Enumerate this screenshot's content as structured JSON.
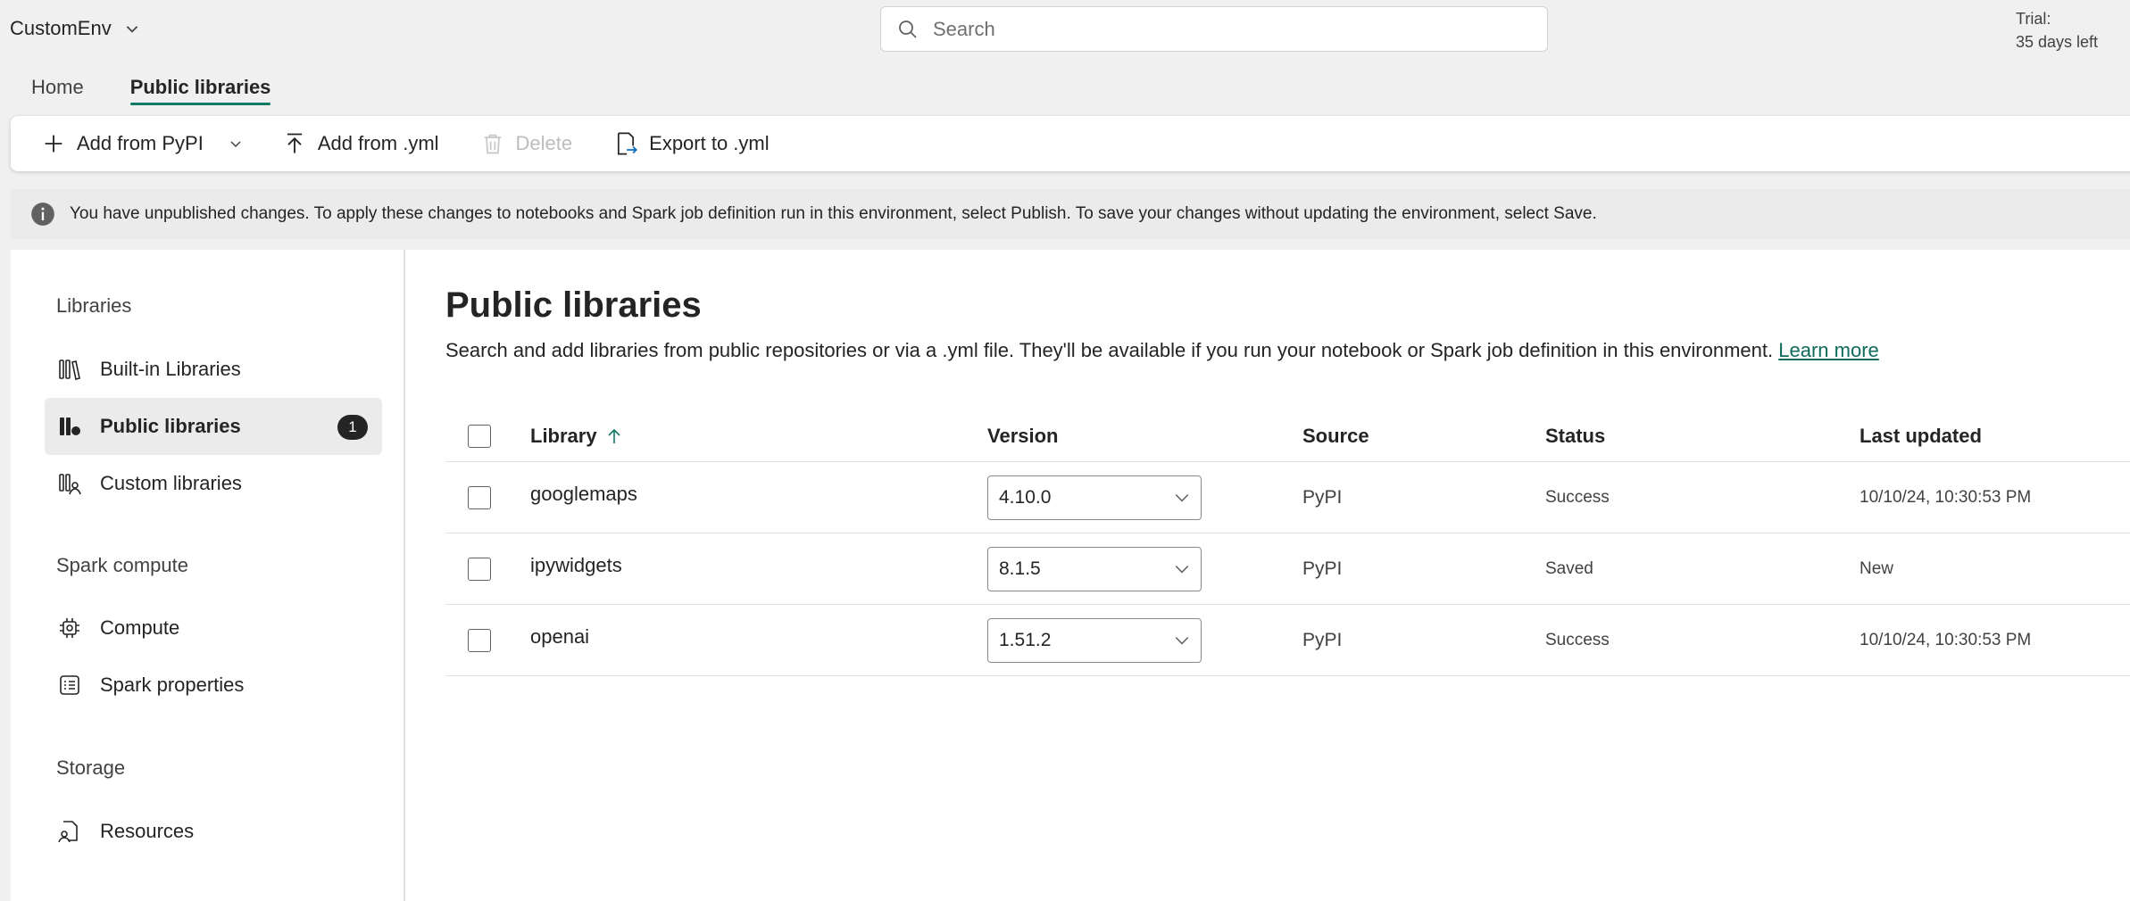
{
  "header": {
    "workspace": "CustomEnv",
    "search_placeholder": "Search",
    "trial_line1": "Trial:",
    "trial_line2": "35 days left"
  },
  "tabs": [
    {
      "label": "Home",
      "active": false
    },
    {
      "label": "Public libraries",
      "active": true
    }
  ],
  "toolbar": {
    "add_pypi": "Add from PyPI",
    "add_yml": "Add from .yml",
    "delete": "Delete",
    "export": "Export to .yml"
  },
  "infobar": {
    "message": "You have unpublished changes. To apply these changes to notebooks and Spark job definition run in this environment, select Publish. To save your changes without updating the environment, select Save."
  },
  "sidebar": {
    "sections": [
      {
        "title": "Libraries",
        "items": [
          {
            "label": "Built-in Libraries",
            "icon": "library-icon"
          },
          {
            "label": "Public libraries",
            "icon": "public-library-icon",
            "badge": "1",
            "active": true
          },
          {
            "label": "Custom libraries",
            "icon": "custom-library-icon"
          }
        ]
      },
      {
        "title": "Spark compute",
        "items": [
          {
            "label": "Compute",
            "icon": "chip-icon"
          },
          {
            "label": "Spark properties",
            "icon": "list-icon"
          }
        ]
      },
      {
        "title": "Storage",
        "items": [
          {
            "label": "Resources",
            "icon": "document-person-icon"
          }
        ]
      }
    ]
  },
  "main": {
    "title": "Public libraries",
    "description": "Search and add libraries from public repositories or via a .yml file. They'll be available if you run your notebook or Spark job definition in this environment.",
    "learn_more": "Learn more",
    "table": {
      "columns": [
        "Library",
        "Version",
        "Source",
        "Status",
        "Last updated"
      ],
      "rows": [
        {
          "library": "googlemaps",
          "version": "4.10.0",
          "source": "PyPI",
          "status": "Success",
          "updated": "10/10/24, 10:30:53 PM"
        },
        {
          "library": "ipywidgets",
          "version": "8.1.5",
          "source": "PyPI",
          "status": "Saved",
          "updated": "New"
        },
        {
          "library": "openai",
          "version": "1.51.2",
          "source": "PyPI",
          "status": "Success",
          "updated": "10/10/24, 10:30:53 PM"
        }
      ]
    }
  },
  "colors": {
    "accent": "#117865",
    "link": "#0f6a5b"
  }
}
